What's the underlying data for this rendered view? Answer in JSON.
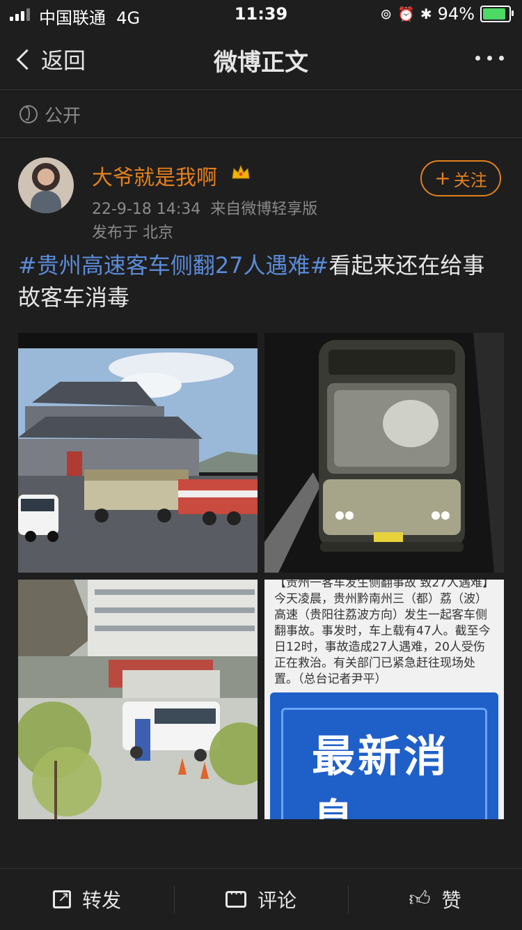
{
  "status_bar": {
    "carrier": "中国联通",
    "network": "4G",
    "time": "11:39",
    "battery": "94%"
  },
  "nav": {
    "back_label": "返回",
    "title": "微博正文"
  },
  "visibility": {
    "label": "公开"
  },
  "post": {
    "username": "大爷就是我啊",
    "timestamp": "22-9-18 14:34",
    "source": "来自微博轻享版",
    "location": "发布于 北京",
    "follow_label": "关注",
    "hashtag": "#贵州高速客车侧翻27人遇难#",
    "text": "看起来还在给事故客车消毒"
  },
  "images": {
    "news_text": "【贵州一客车发生侧翻事故 致27人遇难】今天凌晨，贵州黔南州三（都）荔（波）高速（贵阳往荔波方向）发生一起客车侧翻事故。事发时，车上载有47人。截至今日12时，事故造成27人遇难，20人受伤正在救治。有关部门已紧急赶往现场处置。（总台记者尹平）",
    "news_banner": "最新消息"
  },
  "actions": {
    "repost": "转发",
    "comment": "评论",
    "like": "赞"
  },
  "colors": {
    "accent": "#e4801e",
    "link": "#5b8bd9",
    "background": "#1e1e1e"
  }
}
